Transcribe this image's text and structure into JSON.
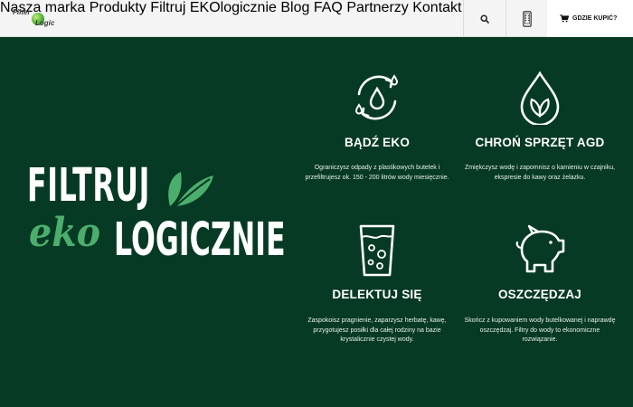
{
  "brand": {
    "logo_line1": "Filter",
    "logo_line2": "Logic"
  },
  "nav": {
    "items": [
      "Nasza marka",
      "Produkty",
      "Filtruj EKOlogicznie",
      "Blog",
      "FAQ",
      "Partnerzy",
      "Kontakt"
    ]
  },
  "header": {
    "search_icon": "search-icon",
    "phone_icon": "phone-icon",
    "buy_label": "GDZIE KUPIĆ?"
  },
  "hero": {
    "slogan_line1": "FILTRUJ",
    "slogan_eko": "eko",
    "slogan_line2": "LOGICZNIE"
  },
  "features": [
    {
      "icon": "eco-water-cycle-icon",
      "title": "BĄDŹ EKO",
      "desc": "Ograniczysz odpady z plastikowych butelek i przefiltrujesz ok. 150 - 200 litrów wody miesięcznie."
    },
    {
      "icon": "water-drop-leaf-icon",
      "title": "CHROŃ SPRZĘT AGD",
      "desc": "Zmiękczysz wodę i zapomnisz o kamieniu w czajniku, ekspresie do kawy oraz żelazku."
    },
    {
      "icon": "glass-of-water-icon",
      "title": "DELEKTUJ SIĘ",
      "desc": "Zaspokoisz pragnienie, zaparzysz herbatę, kawę, przygotujesz posiłki dla całej rodziny na bazie krystalicznie czystej wody."
    },
    {
      "icon": "piggy-bank-icon",
      "title": "OSZCZĘDZAJ",
      "desc": "Skończ z kupowaniem wody butelkowanej i naprawdę oszczędzaj. Filtry do wody to ekonomiczne rozwiązanie."
    }
  ],
  "colors": {
    "background": "#063a24",
    "accent_green": "#4cae6c",
    "header_bg": "#f4f4f4"
  }
}
